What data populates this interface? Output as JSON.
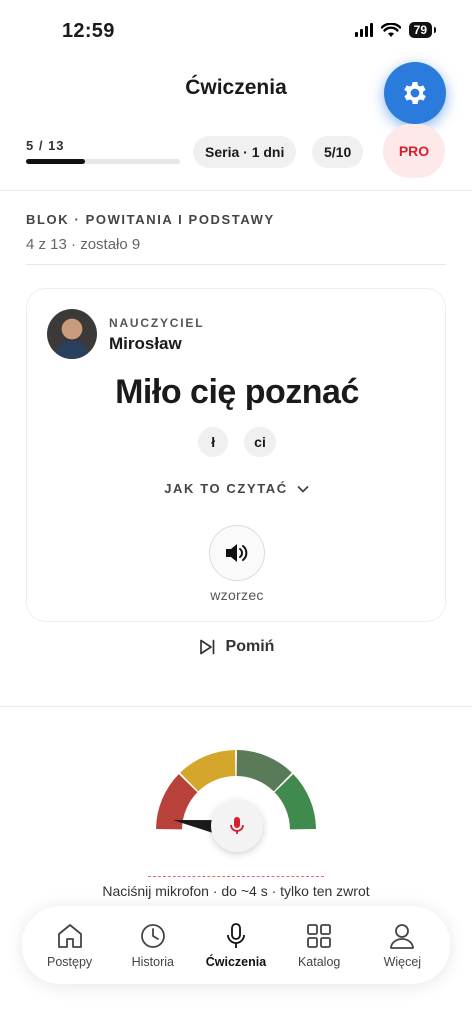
{
  "status_bar": {
    "time": "12:59",
    "battery": "79"
  },
  "header": {
    "title": "Ćwiczenia"
  },
  "progress": {
    "text": "5 / 13",
    "fraction": 0.38
  },
  "pills": {
    "streak": "Seria · 1 dni",
    "score": "5/10",
    "pro": "PRO"
  },
  "block": {
    "title": "BLOK · POWITANIA I PODSTAWY",
    "subtitle": "4 z 13 · zostało 9"
  },
  "card": {
    "teacher_label": "NAUCZYCIEL",
    "teacher_name": "Mirosław",
    "phrase": "Miło cię poznać",
    "chips": [
      "ł",
      "ci"
    ],
    "how_to_read": "JAK TO CZYTAĆ",
    "pattern_label": "wzorzec"
  },
  "skip_label": "Pomiń",
  "gauge": {
    "colors": [
      "#b8423a",
      "#d4a72c",
      "#5a7a58",
      "#3f8a4c"
    ],
    "needle_level": 0.05
  },
  "hint": "Naciśnij mikrofon · do ~4 s · tylko ten zwrot",
  "tabs": [
    {
      "label": "Postępy",
      "icon": "home-icon"
    },
    {
      "label": "Historia",
      "icon": "clock-icon"
    },
    {
      "label": "Ćwiczenia",
      "icon": "microphone-icon",
      "active": true
    },
    {
      "label": "Katalog",
      "icon": "grid-icon"
    },
    {
      "label": "Więcej",
      "icon": "person-icon"
    }
  ],
  "colors": {
    "accent": "#2a7bdc",
    "pro_text": "#d4202f",
    "pro_bg": "#fde9ea",
    "mic": "#d4202f"
  }
}
